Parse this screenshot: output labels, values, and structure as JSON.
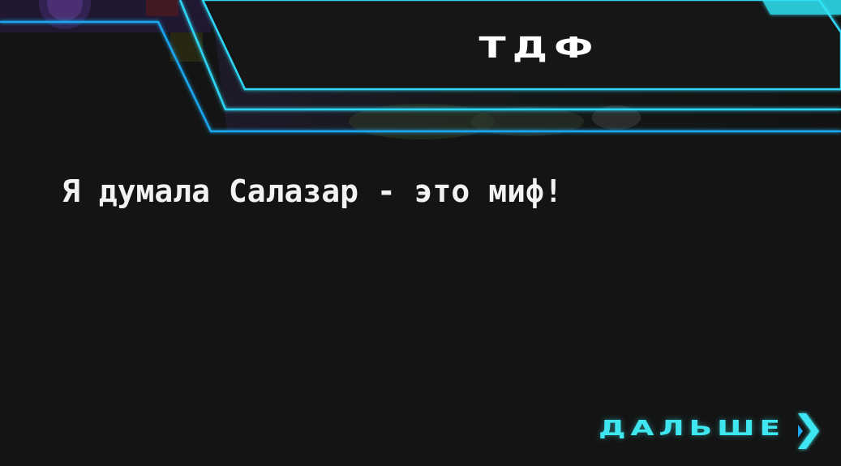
{
  "dialogue": {
    "speaker": "ТДФ",
    "text": "Я думала Салазар - это миф!"
  },
  "controls": {
    "next_label": "ДАЛЬШЕ"
  },
  "icons": {
    "next": "chevron-right-icon"
  },
  "colors": {
    "background": "#141414",
    "frame_accent": "#2fd6f5",
    "frame_outer": "#1aa8f0",
    "next_accent": "#3ee6f0",
    "text": "#ffffff"
  }
}
